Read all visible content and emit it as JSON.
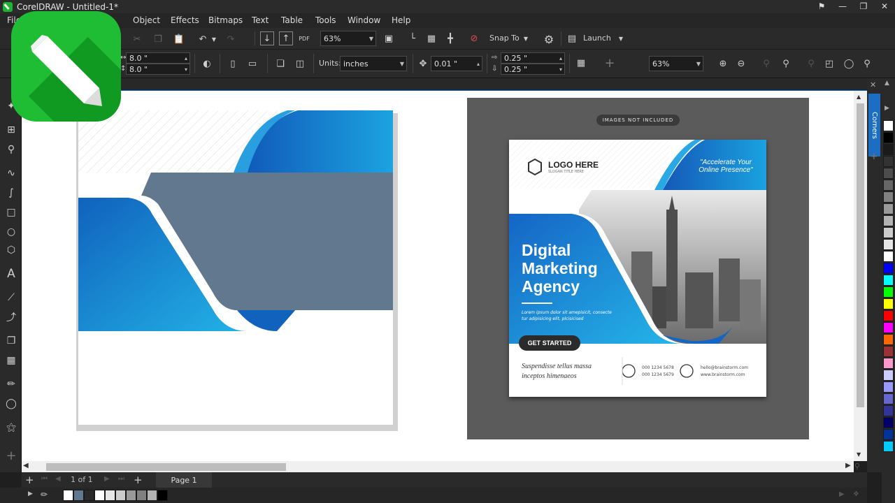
{
  "window": {
    "title": "CorelDRAW - Untitled-1*"
  },
  "menu": [
    "File",
    "Object",
    "Effects",
    "Bitmaps",
    "Text",
    "Table",
    "Tools",
    "Window",
    "Help"
  ],
  "toolbar1": {
    "zoom": "63%",
    "snap_label": "Snap To",
    "launch_label": "Launch",
    "pdf_label": "PDF"
  },
  "toolbar2": {
    "width": "8.0 \"",
    "height": "8.0 \"",
    "units_label": "Units:",
    "units_value": "inches",
    "nudge": "0.01 \"",
    "dup_x": "0.25 \"",
    "dup_y": "0.25 \"",
    "zoom": "63%"
  },
  "docker": {
    "tab_label": "Corners"
  },
  "pagebar": {
    "page_count": "1 of 1",
    "page_tab": "Page 1"
  },
  "flyer": {
    "badge": "IMAGES NOT INCLUDED",
    "logo_text": "LOGO HERE",
    "logo_sub": "SLOGAN TITLE HERE",
    "tagline_1": "\"Accelerate Your",
    "tagline_2": "Online Presence\"",
    "headline_1": "Digital",
    "headline_2": "Marketing",
    "headline_3": "Agency",
    "body_1": "Lorem ipsum dolor sit amepisicit, consecte",
    "body_2": "tur adipisicing elit, plcisicised",
    "cta": "GET STARTED",
    "footer_1": "Suspendisse tellus massa",
    "footer_2": "inceptos himenaeos",
    "phone_1": "000 1234 5678",
    "phone_2": "000 1234 5679",
    "email": "hello@brainstorm.com",
    "web": "www.brainstorm.com"
  },
  "colors": {
    "accent_blue": "#1b6ec2",
    "brand_green": "#1fbd33",
    "panel_gray": "#61788f"
  },
  "palette": [
    "#ffffff",
    "#000000",
    "#1a1a1a",
    "#333333",
    "#4d4d4d",
    "#666666",
    "#808080",
    "#999999",
    "#b3b3b3",
    "#cccccc",
    "#e6e6e6",
    "#ffffff",
    "#0000ff",
    "#00ffff",
    "#00ff00",
    "#ffff00",
    "#ff0000",
    "#ff00ff",
    "#ff6600",
    "#993333",
    "#ff99cc",
    "#ccccff",
    "#9999ff",
    "#6666cc",
    "#333399",
    "#000066",
    "#003399",
    "#00ccff"
  ],
  "status_swatches": [
    "#ffffff",
    "#61788f",
    "#2a2a2a",
    "#ffffff",
    "#e6e6e6",
    "#cccccc",
    "#999999",
    "#808080",
    "#b3b3b3",
    "#000000"
  ]
}
